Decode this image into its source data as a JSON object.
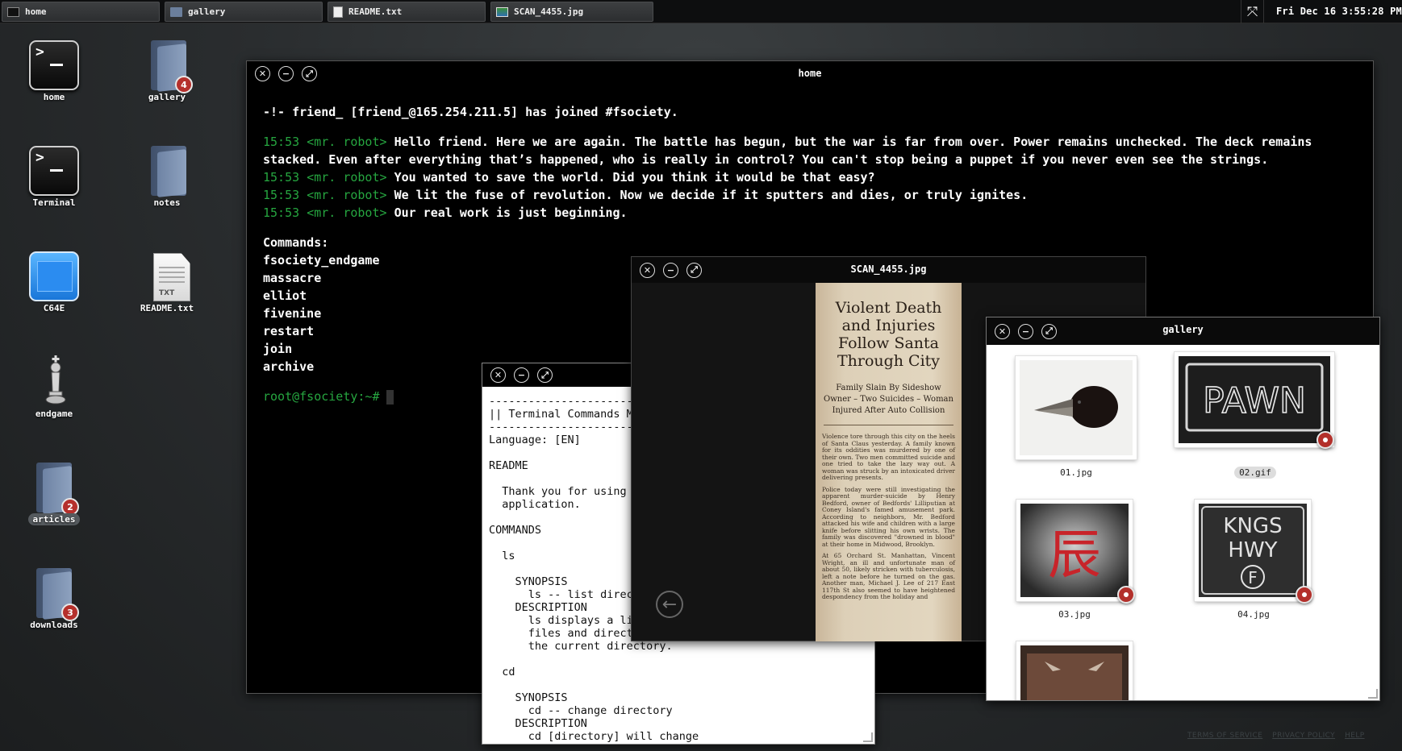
{
  "taskbar": {
    "tabs": [
      {
        "label": "home",
        "icon": "terminal-icon"
      },
      {
        "label": "gallery",
        "icon": "folder-icon"
      },
      {
        "label": "README.txt",
        "icon": "document-icon"
      },
      {
        "label": "SCAN_4455.jpg",
        "icon": "image-icon"
      }
    ],
    "clock": "Fri Dec 16 3:55:28 PM"
  },
  "desktop": {
    "icons": [
      {
        "label": "home"
      },
      {
        "label": "gallery",
        "badge": "4"
      },
      {
        "label": "Terminal"
      },
      {
        "label": "notes"
      },
      {
        "label": "C64E"
      },
      {
        "label": "README.txt",
        "file_type": "TXT"
      },
      {
        "label": "endgame"
      },
      {
        "label": "articles",
        "badge": "2"
      },
      {
        "label": "downloads",
        "badge": "3"
      }
    ]
  },
  "terminal": {
    "title": "home",
    "join_line": "-!- friend_ [friend_@165.254.211.5] has joined #fsociety.",
    "messages": [
      {
        "time": "15:53",
        "nick": "<mr. robot>",
        "text": "Hello friend. Here we are again. The battle has begun, but the war is far from over. Power remains unchecked. The deck remains stacked. Even after everything that’s happened, who is really in control? You can't stop being a puppet if you never even see the strings."
      },
      {
        "time": "15:53",
        "nick": "<mr. robot>",
        "text": "You wanted to save the world. Did you think it would be that easy?"
      },
      {
        "time": "15:53",
        "nick": "<mr. robot>",
        "text": "We lit the fuse of revolution. Now we decide if it sputters and dies, or truly ignites."
      },
      {
        "time": "15:53",
        "nick": "<mr. robot>",
        "text": "Our real work is just beginning."
      }
    ],
    "commands_header": "Commands:",
    "commands": [
      "fsociety_endgame",
      "massacre",
      "elliot",
      "fivenine",
      "restart",
      "join",
      "archive"
    ],
    "prompt": "root@fsociety:~#"
  },
  "readme": {
    "text": "----------------------------\n|| Terminal Commands M\n----------------------------\nLanguage: [EN]\n\nREADME\n\n  Thank you for using\n  application.\n\nCOMMANDS\n\n  ls\n\n    SYNOPSIS\n      ls -- list direc\n    DESCRIPTION\n      ls displays a li\n      files and direct\n      the current directory.\n\n  cd\n\n    SYNOPSIS\n      cd -- change directory\n    DESCRIPTION\n      cd [directory] will change"
  },
  "scan": {
    "title": "SCAN_4455.jpg",
    "headline": "Violent Death and Injuries Follow Santa Through City",
    "subhead": "Family Slain By Sideshow Owner – Two Suicides – Woman Injured After Auto Collision",
    "para1": "Violence tore through this city on the heels of Santa Claus yesterday. A family known for its oddities was murdered by one of their own. Two men committed suicide and one tried to take the lazy way out. A woman was struck by an intoxicated driver delivering presents.",
    "para2": "Police today were still investigating the apparent murder-suicide by Henry Bedford, owner of Bedfords' Lilliputian at Coney Island's famed amusement park. According to neighbors, Mr. Bedford attacked his wife and children with a large knife before slitting his own wrists. The family was discovered \"drowned in blood\" at their home in Midwood, Brooklyn.",
    "para3": "At 65 Orchard St. Manhattan, Vincent Wright, an ill and unfortunate man of about 50, likely stricken with tuberculosis, left a note before he turned on the gas. Another man, Michael J. Lee of 217 East 117th St also seemed to have heightened despondency from the holiday and"
  },
  "gallery": {
    "title": "gallery",
    "items": [
      {
        "label": "01.jpg",
        "selected": false
      },
      {
        "label": "02.gif",
        "selected": true
      },
      {
        "label": "03.jpg",
        "selected": false
      },
      {
        "label": "04.jpg",
        "selected": false
      }
    ],
    "sign_pawn": "PAWN",
    "sign_kanji": "辰",
    "sign_kngs": "KNGS",
    "sign_hwy": "HWY",
    "sign_f": "F"
  },
  "footer": {
    "links": [
      "TERMS OF SERVICE",
      "PRIVACY POLICY",
      "HELP"
    ]
  },
  "colors": {
    "accent_green": "#26a640",
    "badge_red": "#b5302c"
  }
}
